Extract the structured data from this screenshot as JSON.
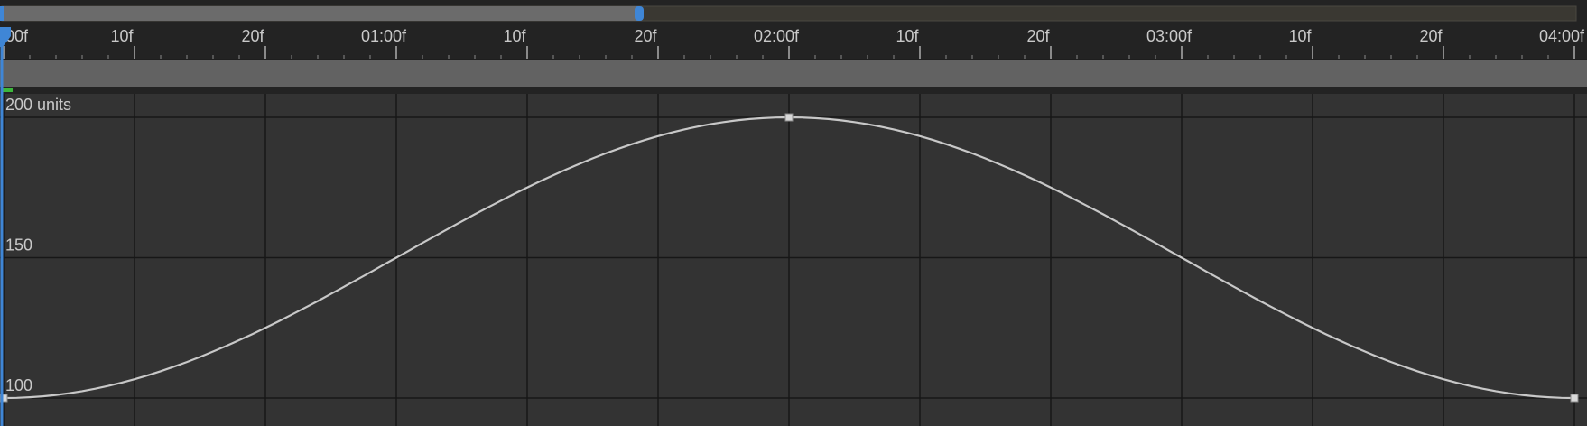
{
  "work_area": {
    "fill_fraction": 0.404
  },
  "ruler": {
    "labels": [
      "00f",
      "10f",
      "20f",
      "01:00f",
      "10f",
      "20f",
      "02:00f",
      "10f",
      "20f",
      "03:00f",
      "10f",
      "20f",
      "04:00f"
    ]
  },
  "graph": {
    "y_labels": [
      {
        "text": "200 units",
        "value": 200
      },
      {
        "text": "150",
        "value": 150
      },
      {
        "text": "100",
        "value": 100
      }
    ]
  },
  "chart_data": {
    "type": "line",
    "x_unit": "frames",
    "fps": 30,
    "xlim": [
      0,
      120
    ],
    "ylim": [
      100,
      200
    ],
    "grid": true,
    "keyframes": [
      {
        "x": 0,
        "y": 100
      },
      {
        "x": 60,
        "y": 200
      },
      {
        "x": 120,
        "y": 100
      }
    ],
    "interpolation": "easy-ease"
  },
  "colors": {
    "background": "#232323",
    "graph_bg": "#333333",
    "grid": "#171717",
    "curve": "#c8c8c8",
    "playhead": "#3f86d6",
    "work_area": "#6b6b6b",
    "work_area_track": "#3a3832",
    "cache_bar": "#3cb83c"
  }
}
